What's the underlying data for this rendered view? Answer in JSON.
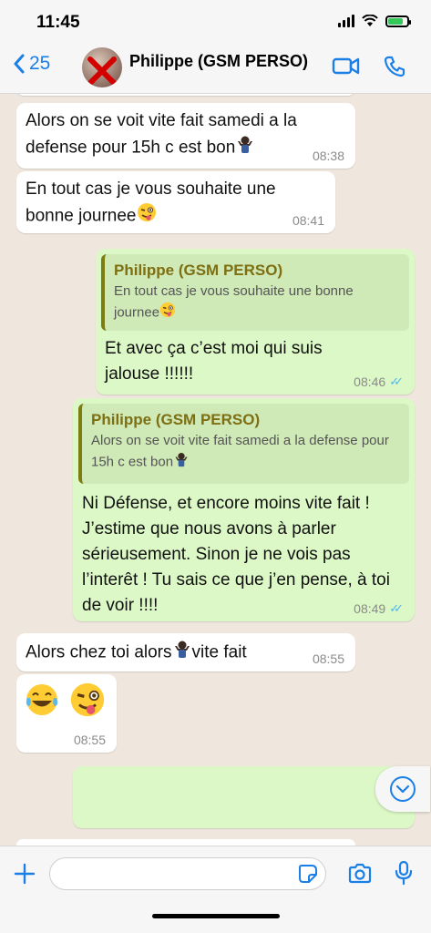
{
  "status": {
    "time": "11:45"
  },
  "header": {
    "back_count": "25",
    "contact_name": "Philippe (GSM PERSO)"
  },
  "messages": [
    {
      "dir": "in",
      "text": "Alors on se voit vite fait samedi a la defense pour 15h c est bon",
      "time": "08:38"
    },
    {
      "dir": "in",
      "text": "En tout cas je vous souhaite une bonne journee",
      "time": "08:41"
    },
    {
      "dir": "out",
      "quote_author": "Philippe (GSM PERSO)",
      "quote_text": "En tout cas je vous souhaite une bonne journee",
      "text": "Et avec ça c’est moi qui suis jalouse !!!!!!",
      "time": "08:46"
    },
    {
      "dir": "out",
      "quote_author": "Philippe (GSM PERSO)",
      "quote_text": "Alors on se voit vite fait samedi a la defense pour 15h c est bon",
      "text": "Ni Défense, et encore moins vite fait ! J’estime que nous avons à parler sérieusement. Sinon je ne vois pas l’interêt ! Tu sais ce que j’en pense, à toi de voir !!!!",
      "time": "08:49"
    },
    {
      "dir": "in",
      "text_before": "Alors chez toi alors",
      "text_after": "vite fait",
      "time": "08:55"
    },
    {
      "dir": "in",
      "emoji_only": "laughing-crying + winking-tongue",
      "time": "08:55"
    }
  ],
  "icons": {
    "back": "chevron-left-icon",
    "video": "video-camera-icon",
    "phone": "phone-icon",
    "plus": "plus-icon",
    "sticker": "sticker-icon",
    "camera": "camera-icon",
    "mic": "microphone-icon",
    "scroll": "chevron-down-icon"
  },
  "colors": {
    "accent": "#1a7fe6",
    "outgoing": "#dcf8c6",
    "incoming": "#ffffff",
    "quote_author": "#7d6f12",
    "read_ticks": "#4fb6ec"
  }
}
